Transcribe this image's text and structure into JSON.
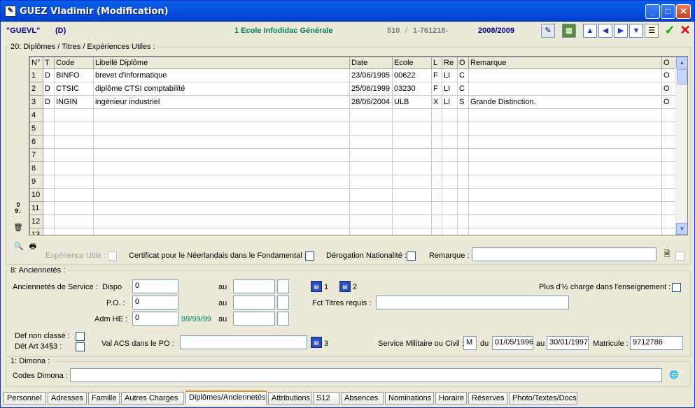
{
  "window": {
    "title": "GUEZ Vladimir (Modification)"
  },
  "header": {
    "code": "\"GUEVL\"",
    "flag": "(D)",
    "school": "1 Ecole Infodidac Générale",
    "num1": "510",
    "sep": "/",
    "num2": "1-761218-",
    "year": "2008/2009"
  },
  "diplomas": {
    "legend": "20: Diplômes / Titres / Expériences Utiles :",
    "columns": [
      "N°",
      "T",
      "Code",
      "Libellé Diplôme",
      "Date",
      "Ecole",
      "L",
      "Re",
      "O",
      "Remarque",
      "O"
    ],
    "rows": [
      {
        "n": "1",
        "t": "D",
        "code": "BINFO",
        "libelle": "brevet d'informatique",
        "date": "23/06/1995",
        "ecole": "00622",
        "l": "F",
        "re": "LI",
        "o": "C",
        "remarque": "",
        "o2": "O"
      },
      {
        "n": "2",
        "t": "D",
        "code": "CTSIC",
        "libelle": "diplôme CTSI comptabilité",
        "date": "25/06/1999",
        "ecole": "03230",
        "l": "F",
        "re": "LI",
        "o": "C",
        "remarque": "",
        "o2": "O"
      },
      {
        "n": "3",
        "t": "D",
        "code": "INGIN",
        "libelle": "ingénieur industriel",
        "date": "28/06/2004",
        "ecole": "ULB",
        "l": "X",
        "re": "LI",
        "o": "S",
        "remarque": "Grande Distinction.",
        "o2": "O"
      },
      {
        "n": "4"
      },
      {
        "n": "5"
      },
      {
        "n": "6"
      },
      {
        "n": "7"
      },
      {
        "n": "8"
      },
      {
        "n": "9"
      },
      {
        "n": "10"
      },
      {
        "n": "11"
      },
      {
        "n": "12"
      },
      {
        "n": "13"
      }
    ],
    "experience_label": "Expérience Utile :",
    "certificat_label": "Certificat pour le Néerlandais dans le Fondamental :",
    "derogation_label": "Dérogation Nationalité :",
    "remarque_label": "Remarque :"
  },
  "anciennetes": {
    "legend": "8: Anciennetés :",
    "service_label": "Anciennetés de Service :",
    "dispo_label": "Dispo",
    "dispo_value": "0",
    "po_label": "P.O. :",
    "po_value": "0",
    "adm_label": "Adm HE :",
    "adm_value": "0",
    "adm_hint": "99/99/99",
    "au_label": "au",
    "btn1": "1",
    "btn2": "2",
    "btn3": "3",
    "charge_label": "Plus d'½ charge dans l'enseignement :",
    "fct_label": "Fct Titres requis :",
    "def_label": "Def non classé :",
    "det_label": "Dét Art 34§3 :",
    "val_label": "Val ACS dans le PO :",
    "service_mil_label": "Service Militaire ou Civil :",
    "service_mil_value": "M",
    "du_label": "du",
    "du_value": "01/05/1996",
    "au_value": "30/01/1997",
    "matricule_label": "Matricule :",
    "matricule_value": "9712786"
  },
  "dimona": {
    "legend": "1: Dimona :",
    "codes_label": "Codes Dimona :"
  },
  "tabs": [
    "Personnel",
    "Adresses",
    "Famille",
    "Autres Charges",
    "Diplômes/Anciennetés",
    "Attributions",
    "S12",
    "Absences",
    "Nominations",
    "Horaire",
    "Réserves",
    "Photo/Textes/Docs"
  ],
  "active_tab": "Diplômes/Anciennetés",
  "icons": {
    "sort": "sort-numeric-icon",
    "trash": "trash-icon",
    "preview": "print-preview-icon",
    "print": "print-icon",
    "note": "note-icon",
    "globe": "globe-icon"
  }
}
